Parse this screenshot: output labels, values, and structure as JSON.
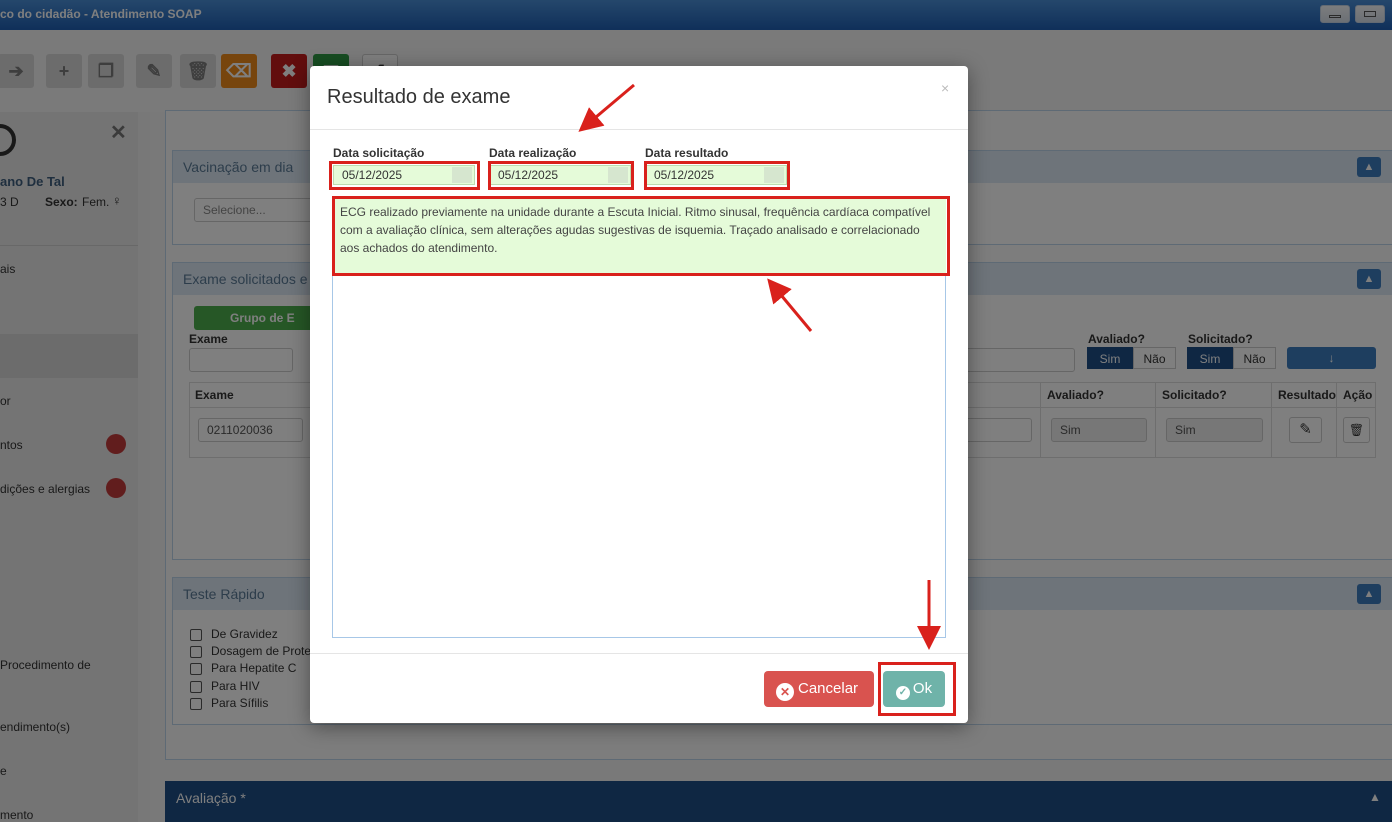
{
  "window": {
    "title": "co do cidadão - Atendimento SOAP"
  },
  "patient": {
    "name_partial": "ano De Tal",
    "id_partial": "3 D",
    "sex_label": "Sexo:",
    "sex_value": "Fem."
  },
  "sidebar": {
    "items": [
      "ais",
      "or",
      "ntos",
      "dições e alergias",
      "Procedimento de",
      "endimento(s)",
      "e",
      "mento"
    ]
  },
  "panels": {
    "vacinacao": {
      "title": "Vacinação em dia",
      "select_placeholder": "Selecione..."
    },
    "exames": {
      "title": "Exame solicitados e",
      "group_button": "Grupo de E",
      "exame_label": "Exame",
      "avaliado_label": "Avaliado?",
      "solicitado_label": "Solicitado?",
      "sim": "Sim",
      "nao": "Não",
      "columns": [
        "Exame",
        "Avaliado?",
        "Solicitado?",
        "Resultado",
        "Ação"
      ],
      "row": {
        "code": "0211020036",
        "avaliado": "Sim",
        "solicitado": "Sim"
      }
    },
    "teste_rapido": {
      "title": "Teste Rápido",
      "items": [
        "De Gravidez",
        "Dosagem de Prote",
        "Para Hepatite C",
        "Para HIV",
        "Para Sífilis"
      ]
    },
    "avaliacao": {
      "title": "Avaliação *"
    }
  },
  "modal": {
    "title": "Resultado de exame",
    "close": "×",
    "data_solicitacao_label": "Data solicitação",
    "data_solicitacao": "05/12/2025",
    "data_realizacao_label": "Data realização",
    "data_realizacao": "05/12/2025",
    "data_resultado_label": "Data resultado",
    "data_resultado": "05/12/2025",
    "result_text": "ECG realizado previamente na unidade durante a Escuta Inicial. Ritmo sinusal, frequência cardíaca compatível com a avaliação clínica, sem alterações agudas sugestivas de isquemia. Traçado analisado e correlacionado aos achados do atendimento.",
    "cancel_label": "Cancelar",
    "ok_label": "Ok"
  },
  "colors": {
    "annotation": "#d9211c",
    "primary": "#1f4f86",
    "danger": "#d9534f",
    "ok": "#6fb3a9"
  }
}
